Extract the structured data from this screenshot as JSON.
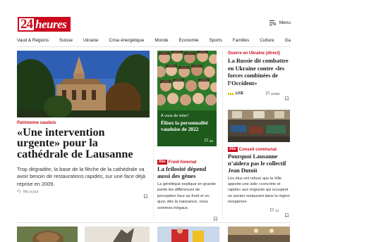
{
  "header": {
    "logo_number": "24",
    "logo_word": "heures",
    "menu_label": "Menu"
  },
  "nav": {
    "items": [
      "Vaud & Régions",
      "Suisse",
      "Ukraine",
      "Crise énergétique",
      "Monde",
      "Économie",
      "Sports",
      "Familles",
      "Culture",
      "Gastro"
    ]
  },
  "main_article": {
    "kicker": "Patrimoine vaudois",
    "title": "«Une intervention urgente» pour la cathédrale de Lausanne",
    "lead": "Trop dégradée, la base de la flèche de la cathédrale va avoir besoin de restaurations rapides, sur une face déjà reprise en 2009.",
    "meta": "Mis à jour"
  },
  "promo": {
    "kicker": "À vous de voter!",
    "title": "Élisez la personnalité vaudoise de 2022",
    "comment_count": "46"
  },
  "mid_article": {
    "badge": "Abo",
    "kicker": "Froid hivernal",
    "title": "La frilosité dépend aussi des gènes",
    "lead": "La génétique explique en grande partie les différences de perception face au froid et en quoi, dès la naissance, nous sommes inégaux."
  },
  "right_article_1": {
    "kicker": "Guerre en Ukraine (direct)",
    "title": "La Russie dit combattre en Ukraine contre «les forces combinées de l’Occident»",
    "live_label": "LIVE",
    "comment_count": "32996"
  },
  "right_article_2": {
    "badge": "Abo",
    "kicker": "Conseil communal",
    "title": "Pourquoi Lausanne n’aidera pas le collectif Jean Dutoit",
    "lead": "Les élus ont refusé que la Ville apporte une aide «concrète et rapide» aux migrants qui occupent un ancien restaurant dans la région morgienne.",
    "comment_count": "13"
  },
  "icons": {
    "menu": "menu-icon",
    "bookmark": "bookmark-icon",
    "comment": "comment-icon",
    "update": "update-icon"
  },
  "colors": {
    "brand_red": "#cc0a1e",
    "promo_green": "#1e5a1c",
    "live_yellow": "#e6b800"
  }
}
